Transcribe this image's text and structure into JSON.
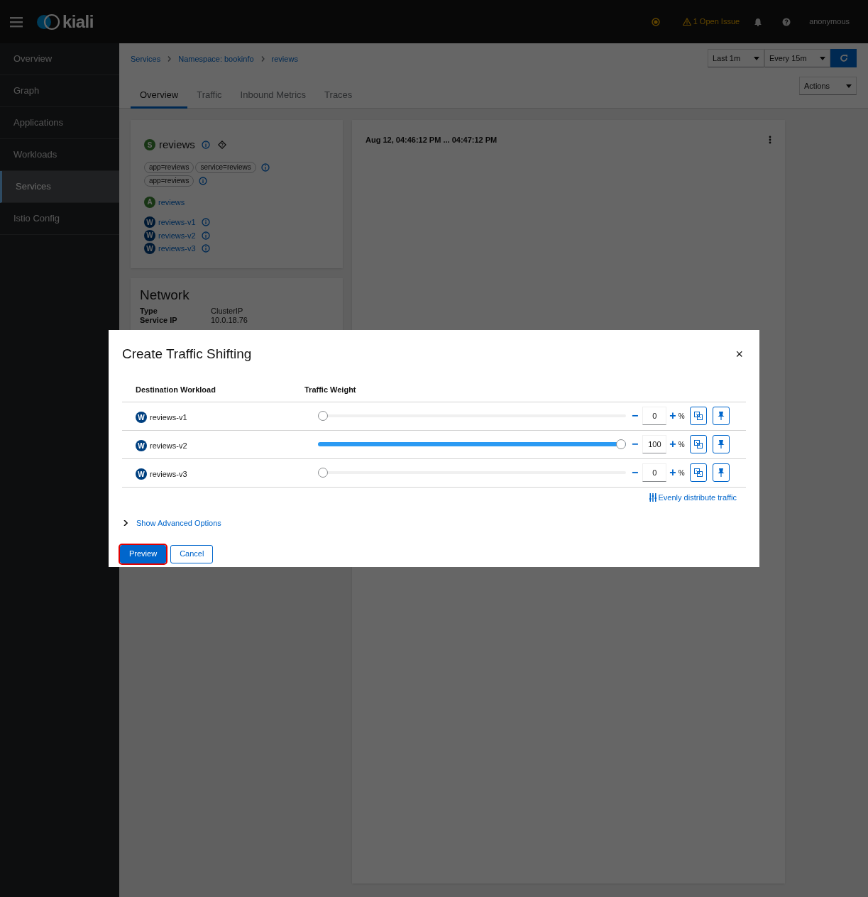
{
  "header": {
    "logo_text": "kiali",
    "issues": "1 Open Issue",
    "user": "anonymous"
  },
  "sidebar": {
    "items": [
      {
        "label": "Overview",
        "selected": false
      },
      {
        "label": "Graph",
        "selected": false
      },
      {
        "label": "Applications",
        "selected": false
      },
      {
        "label": "Workloads",
        "selected": false
      },
      {
        "label": "Services",
        "selected": true
      },
      {
        "label": "Istio Config",
        "selected": false
      }
    ]
  },
  "breadcrumb": [
    "Services",
    "Namespace: bookinfo",
    "reviews"
  ],
  "toolbar": {
    "duration": "Last 1m",
    "refresh": "Every 15m",
    "actions": "Actions"
  },
  "tabs": [
    {
      "label": "Overview",
      "selected": true
    },
    {
      "label": "Traffic",
      "selected": false
    },
    {
      "label": "Inbound Metrics",
      "selected": false
    },
    {
      "label": "Traces",
      "selected": false
    }
  ],
  "service_card": {
    "badge": "S",
    "name": "reviews",
    "label_rows": [
      [
        "app=reviews",
        "service=reviews"
      ],
      [
        "app=reviews"
      ]
    ],
    "app": {
      "badge": "A",
      "name": "reviews"
    },
    "workloads": [
      {
        "badge": "W",
        "name": "reviews-v1"
      },
      {
        "badge": "W",
        "name": "reviews-v2"
      },
      {
        "badge": "W",
        "name": "reviews-v3"
      }
    ]
  },
  "network_card": {
    "title": "Network",
    "rows": [
      {
        "label": "Type",
        "value": "ClusterIP"
      },
      {
        "label": "Service IP",
        "value": "10.0.18.76"
      }
    ]
  },
  "graph_card": {
    "time_range": "Aug 12, 04:46:12 PM ... 04:47:12 PM"
  },
  "modal": {
    "title": "Create Traffic Shifting",
    "close": "×",
    "columns": [
      "Destination Workload",
      "Traffic Weight"
    ],
    "rows": [
      {
        "badge": "W",
        "name": "reviews-v1",
        "level": 0,
        "value": "0"
      },
      {
        "badge": "W",
        "name": "reviews-v2",
        "level": 1,
        "value": "100"
      },
      {
        "badge": "W",
        "name": "reviews-v3",
        "level": 0,
        "value": "0"
      }
    ],
    "minus": "−",
    "plus": "+",
    "unit": "%",
    "distribute": "Evenly distribute traffic",
    "advanced": {
      "label": "Show Advanced Options",
      "expanded": false
    },
    "buttons": [
      {
        "label": "Preview",
        "kind": "primary",
        "highlighted": true
      },
      {
        "label": "Cancel",
        "kind": "secondary",
        "highlighted": false
      }
    ]
  }
}
